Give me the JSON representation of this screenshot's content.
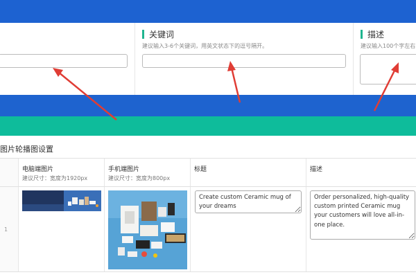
{
  "seo": {
    "keywords": {
      "title": "关键词",
      "hint": "建议输入3-6个关键词，用英文状态下的逗号隔开。",
      "value": ""
    },
    "description": {
      "title": "描述",
      "hint": "建议输入100个字左右",
      "value": ""
    },
    "first_field": {
      "value": ""
    }
  },
  "banner": {
    "section_title": "图片轮播图设置",
    "columns": {
      "pc_image": {
        "label": "电脑端图片",
        "hint": "建议尺寸：宽度为1920px"
      },
      "mobile_image": {
        "label": "手机端图片",
        "hint": "建议尺寸：宽度为800px"
      },
      "title": {
        "label": "标题"
      },
      "description": {
        "label": "描述"
      }
    },
    "rows": [
      {
        "index": "1",
        "title": "Create custom Ceramic mug of your dreams",
        "description": "Order personalized, high-quality custom printed Ceramic mug your customers will love all-in-one place."
      }
    ]
  },
  "colors": {
    "top_bar": "#1d62d1",
    "blue_band": "#1e63cf",
    "green_band": "#0ebc9b",
    "accent_bar": "#1fb58f",
    "annotation_arrow": "#e03d35"
  }
}
